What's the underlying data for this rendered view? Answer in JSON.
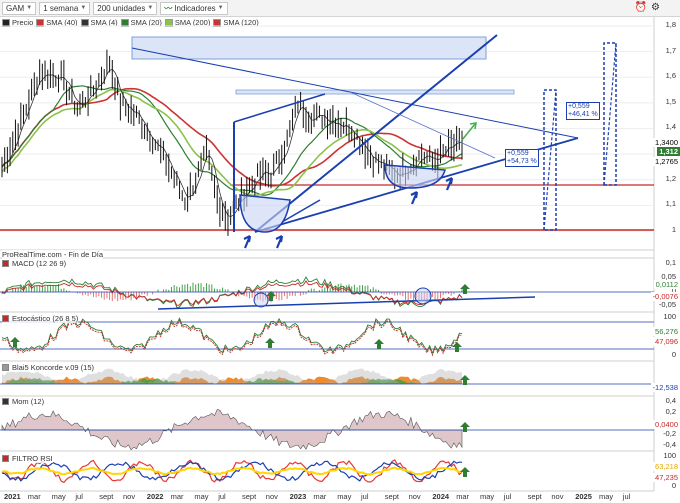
{
  "toolbar": {
    "ticker": "GAM",
    "period": "1 semana",
    "units": "200 unidades",
    "indicators": "Indicadores"
  },
  "legend": [
    {
      "label": "Precio",
      "color": "#222222"
    },
    {
      "label": "SMA (40)",
      "color": "#cc3333"
    },
    {
      "label": "SMA (4)",
      "color": "#333333"
    },
    {
      "label": "SMA (20)",
      "color": "#2e7d32"
    },
    {
      "label": "SMA (200)",
      "color": "#8bc34a"
    },
    {
      "label": "SMA (120)",
      "color": "#cc3333"
    }
  ],
  "source_label": "ProRealTime.com - Fin de Día",
  "price_axis": [
    "1,8",
    "1,7",
    "1,6",
    "1,5",
    "1,4",
    "1,3",
    "1,2",
    "1,1",
    "1"
  ],
  "price_tags": {
    "last": "1,3400",
    "close": "1,312",
    "low": "1,2765"
  },
  "annotations": {
    "box1": {
      "line1": "+0,559",
      "line2": "+46,41 %"
    },
    "box2": {
      "line1": "+0,559",
      "line2": "+54,73 %"
    }
  },
  "panes": {
    "macd": {
      "label": "MACD (12 26 9)",
      "axis": [
        "0,1",
        "0,05",
        "0",
        "-0,05"
      ],
      "v1": "0,0112",
      "v2": "-0,0076"
    },
    "stoch": {
      "label": "Estocástico (26 8 5)",
      "axis": [
        "100",
        "0"
      ],
      "v1": "56,276",
      "v2": "47,096"
    },
    "blai": {
      "label": "Blai5 Koncorde v.09 (15)",
      "axis": [
        "",
        "0"
      ],
      "v1": "-12,538"
    },
    "mom": {
      "label": "Mom (12)",
      "axis": [
        "0,4",
        "0,2",
        "0",
        "-0,2",
        "-0,4"
      ],
      "v1": "0,0400"
    },
    "rsi": {
      "label": "FILTRO RSI",
      "axis": [
        "100",
        "0"
      ],
      "v1": "63,218",
      "v2": "47,235"
    }
  },
  "xaxis": [
    {
      "t": "2021",
      "year": true
    },
    {
      "t": "mar"
    },
    {
      "t": "may"
    },
    {
      "t": "jul"
    },
    {
      "t": "sept"
    },
    {
      "t": "nov"
    },
    {
      "t": "2022",
      "year": true
    },
    {
      "t": "mar"
    },
    {
      "t": "may"
    },
    {
      "t": "jul"
    },
    {
      "t": "sept"
    },
    {
      "t": "nov"
    },
    {
      "t": "2023",
      "year": true
    },
    {
      "t": "mar"
    },
    {
      "t": "may"
    },
    {
      "t": "jul"
    },
    {
      "t": "sept"
    },
    {
      "t": "nov"
    },
    {
      "t": "2024",
      "year": true
    },
    {
      "t": "mar"
    },
    {
      "t": "may"
    },
    {
      "t": "jul"
    },
    {
      "t": "sept"
    },
    {
      "t": "nov"
    },
    {
      "t": "2025",
      "year": true
    },
    {
      "t": "may"
    },
    {
      "t": "jul"
    }
  ],
  "colors": {
    "accent": "#1a3fb0",
    "sma40": "#cc3333",
    "sma20": "#2e7d32",
    "sma200": "#8bc34a",
    "support": "#c62828"
  }
}
